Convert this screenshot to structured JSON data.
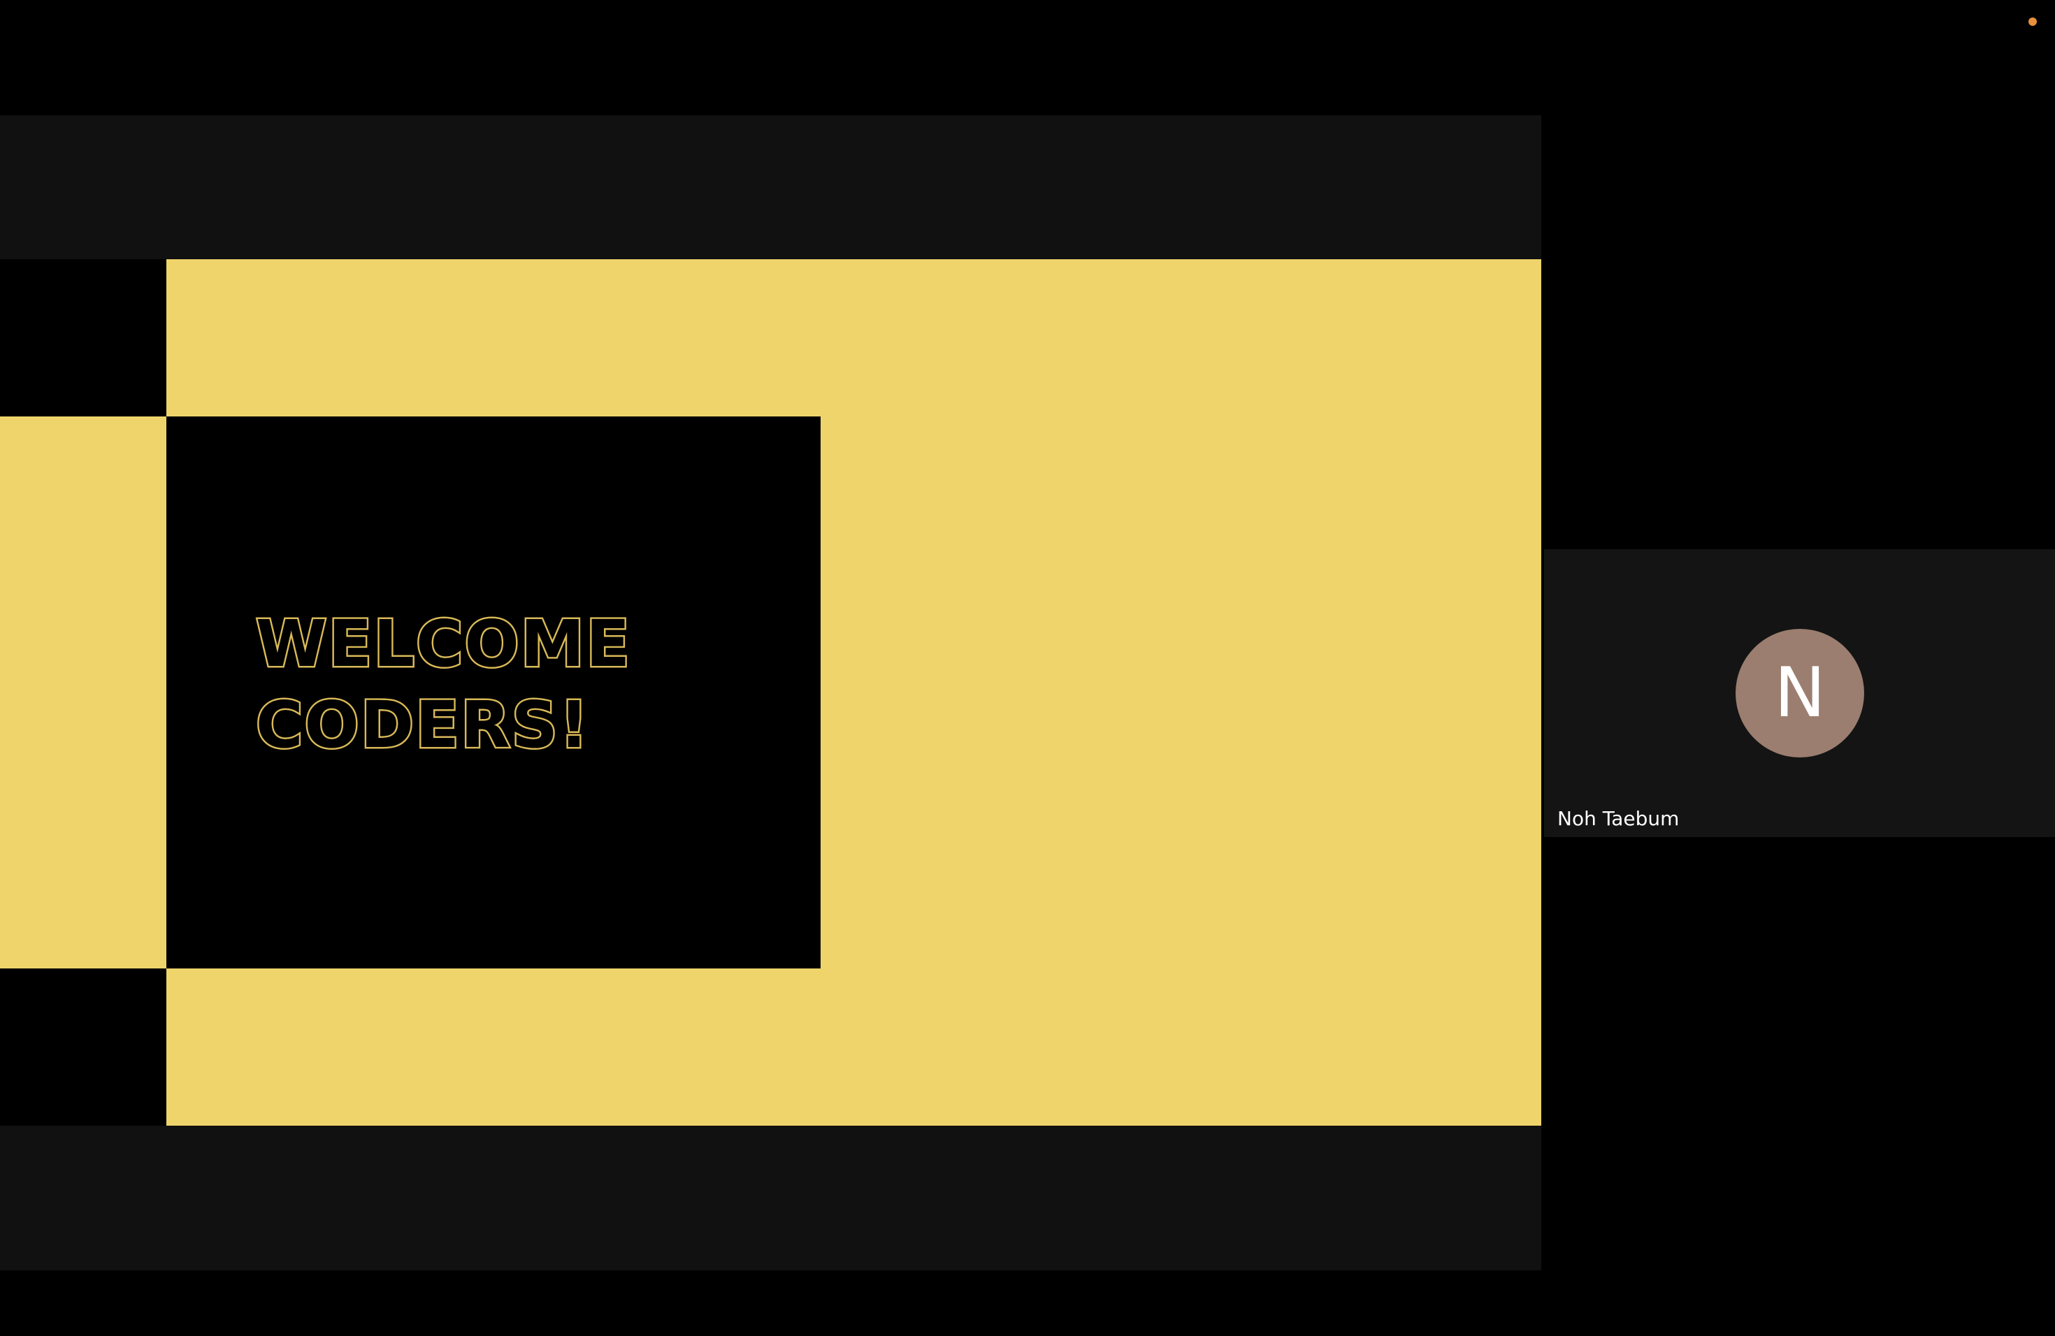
{
  "colors": {
    "background": "#000000",
    "screen_letterbox": "#111111",
    "slide_yellow": "#efd46b",
    "slide_black": "#000000",
    "title_outline": "#d8b957",
    "tile_background": "#141414",
    "avatar_background": "#9b7e6f",
    "status_dot": "#e8903a"
  },
  "shared_screen": {
    "slide": {
      "title_line_1": "Welcome",
      "title_line_2": "Coders!"
    }
  },
  "participants": [
    {
      "avatar_initial": "N",
      "name": "Noh Taebum"
    }
  ],
  "status_indicator": {
    "icon": "dot-indicator-icon"
  }
}
